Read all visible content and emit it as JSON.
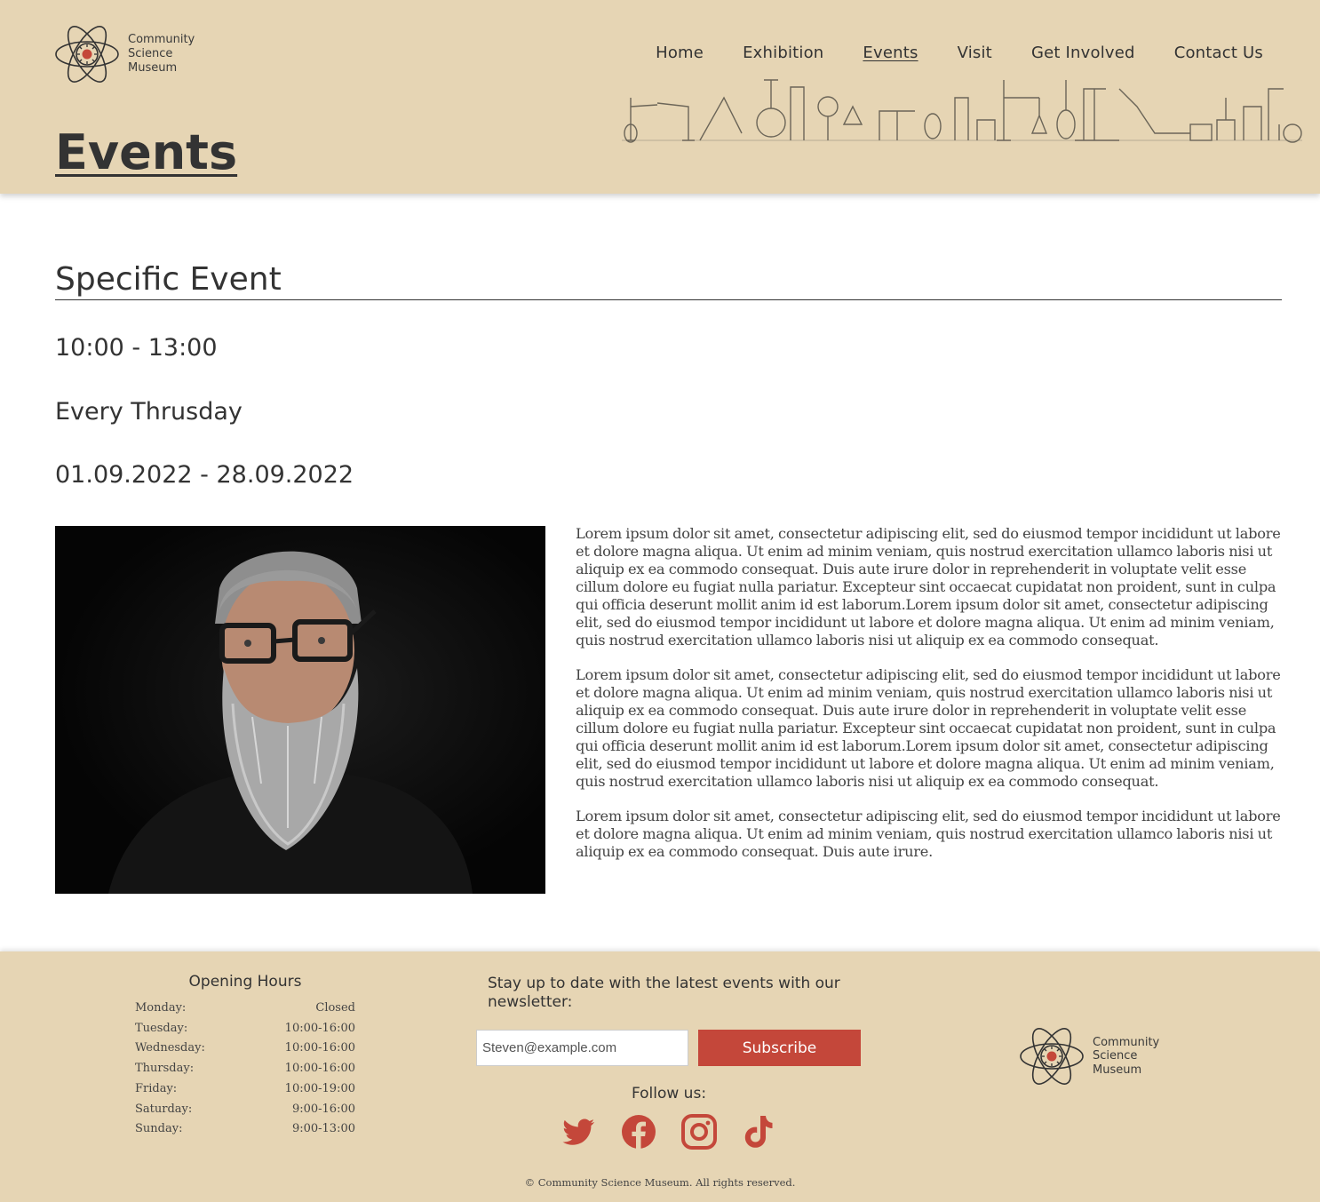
{
  "brand": {
    "name_line1": "Community",
    "name_line2": "Science",
    "name_line3": "Museum",
    "accent_color": "#c4473a",
    "header_bg": "#e6d5b4"
  },
  "nav": {
    "items": [
      {
        "label": "Home"
      },
      {
        "label": "Exhibition"
      },
      {
        "label": "Events",
        "active": true
      },
      {
        "label": "Visit"
      },
      {
        "label": "Get Involved"
      },
      {
        "label": "Contact Us"
      }
    ]
  },
  "page": {
    "title": "Events"
  },
  "event": {
    "title": "Specific Event",
    "time": "10:00 - 13:00",
    "frequency": "Every Thrusday",
    "dates": "01.09.2022 - 28.09.2022",
    "paragraphs": [
      "Lorem ipsum dolor sit amet, consectetur adipiscing elit, sed do eiusmod tempor incididunt ut labore et dolore magna aliqua. Ut enim ad minim veniam, quis nostrud exercitation ullamco laboris nisi ut aliquip ex ea commodo consequat. Duis aute irure dolor in reprehenderit in voluptate velit esse cillum dolore eu fugiat nulla pariatur. Excepteur sint occaecat cupidatat non proident, sunt in culpa qui officia deserunt mollit anim id est laborum.Lorem ipsum dolor sit amet, consectetur adipiscing elit, sed do eiusmod tempor incididunt ut labore et dolore magna aliqua. Ut enim ad minim veniam, quis nostrud exercitation ullamco laboris nisi ut aliquip ex ea commodo consequat.",
      "Lorem ipsum dolor sit amet, consectetur adipiscing elit, sed do eiusmod tempor incididunt ut labore et dolore magna aliqua. Ut enim ad minim veniam, quis nostrud exercitation ullamco laboris nisi ut aliquip ex ea commodo consequat. Duis aute irure dolor in reprehenderit in voluptate velit esse cillum dolore eu fugiat nulla pariatur. Excepteur sint occaecat cupidatat non proident, sunt in culpa qui officia deserunt mollit anim id est laborum.Lorem ipsum dolor sit amet, consectetur adipiscing elit, sed do eiusmod tempor incididunt ut labore et dolore magna aliqua. Ut enim ad minim veniam, quis nostrud exercitation ullamco laboris nisi ut aliquip ex ea commodo consequat.",
      "Lorem ipsum dolor sit amet, consectetur adipiscing elit, sed do eiusmod tempor incididunt ut labore et dolore magna aliqua. Ut enim ad minim veniam, quis nostrud exercitation ullamco laboris nisi ut aliquip ex ea commodo consequat. Duis aute irure."
    ]
  },
  "footer": {
    "hours_title": "Opening Hours",
    "hours": [
      {
        "day": "Monday:",
        "time": "Closed"
      },
      {
        "day": "Tuesday:",
        "time": "10:00-16:00"
      },
      {
        "day": "Wednesday:",
        "time": "10:00-16:00"
      },
      {
        "day": "Thursday:",
        "time": "10:00-16:00"
      },
      {
        "day": "Friday:",
        "time": "10:00-19:00"
      },
      {
        "day": "Saturday:",
        "time": "9:00-16:00"
      },
      {
        "day": "Sunday:",
        "time": "9:00-13:00"
      }
    ],
    "newsletter_text": "Stay up to date with the latest events with our newsletter:",
    "email_placeholder": "Steven@example.com",
    "subscribe_label": "Subscribe",
    "follow_label": "Follow us:",
    "socials": [
      "twitter-icon",
      "facebook-icon",
      "instagram-icon",
      "tiktok-icon"
    ],
    "copyright": "© Community Science Museum. All rights reserved."
  }
}
